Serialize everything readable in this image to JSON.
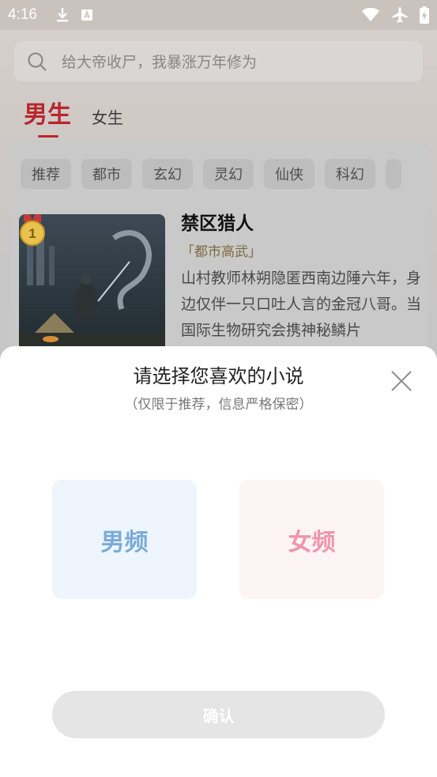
{
  "status_bar": {
    "time": "4:16",
    "icons": [
      "download-icon",
      "a-box-icon",
      "wifi-icon",
      "airplane-icon",
      "battery-charging-icon"
    ]
  },
  "search": {
    "placeholder": "给大帝收尸，我暴涨万年修为"
  },
  "gender_tabs": {
    "male": "男生",
    "female": "女生",
    "active": "male"
  },
  "categories": [
    "推荐",
    "都市",
    "玄幻",
    "灵幻",
    "仙侠",
    "科幻"
  ],
  "book": {
    "rank": "1",
    "title": "禁区猎人",
    "tag": "「都市高武」",
    "description": "山村教师林朔隐匿西南边陲六年，身边仅伴一只口吐人言的金冠八哥。当国际生物研究会携神秘鳞片"
  },
  "sheet": {
    "title": "请选择您喜欢的小说",
    "subtitle": "（仅限于推荐，信息严格保密）",
    "male_option": "男频",
    "female_option": "女频",
    "confirm": "确认"
  },
  "colors": {
    "accent_red": "#b8262e",
    "male_option_text": "#7aabd8",
    "female_option_text": "#ef95ad"
  }
}
